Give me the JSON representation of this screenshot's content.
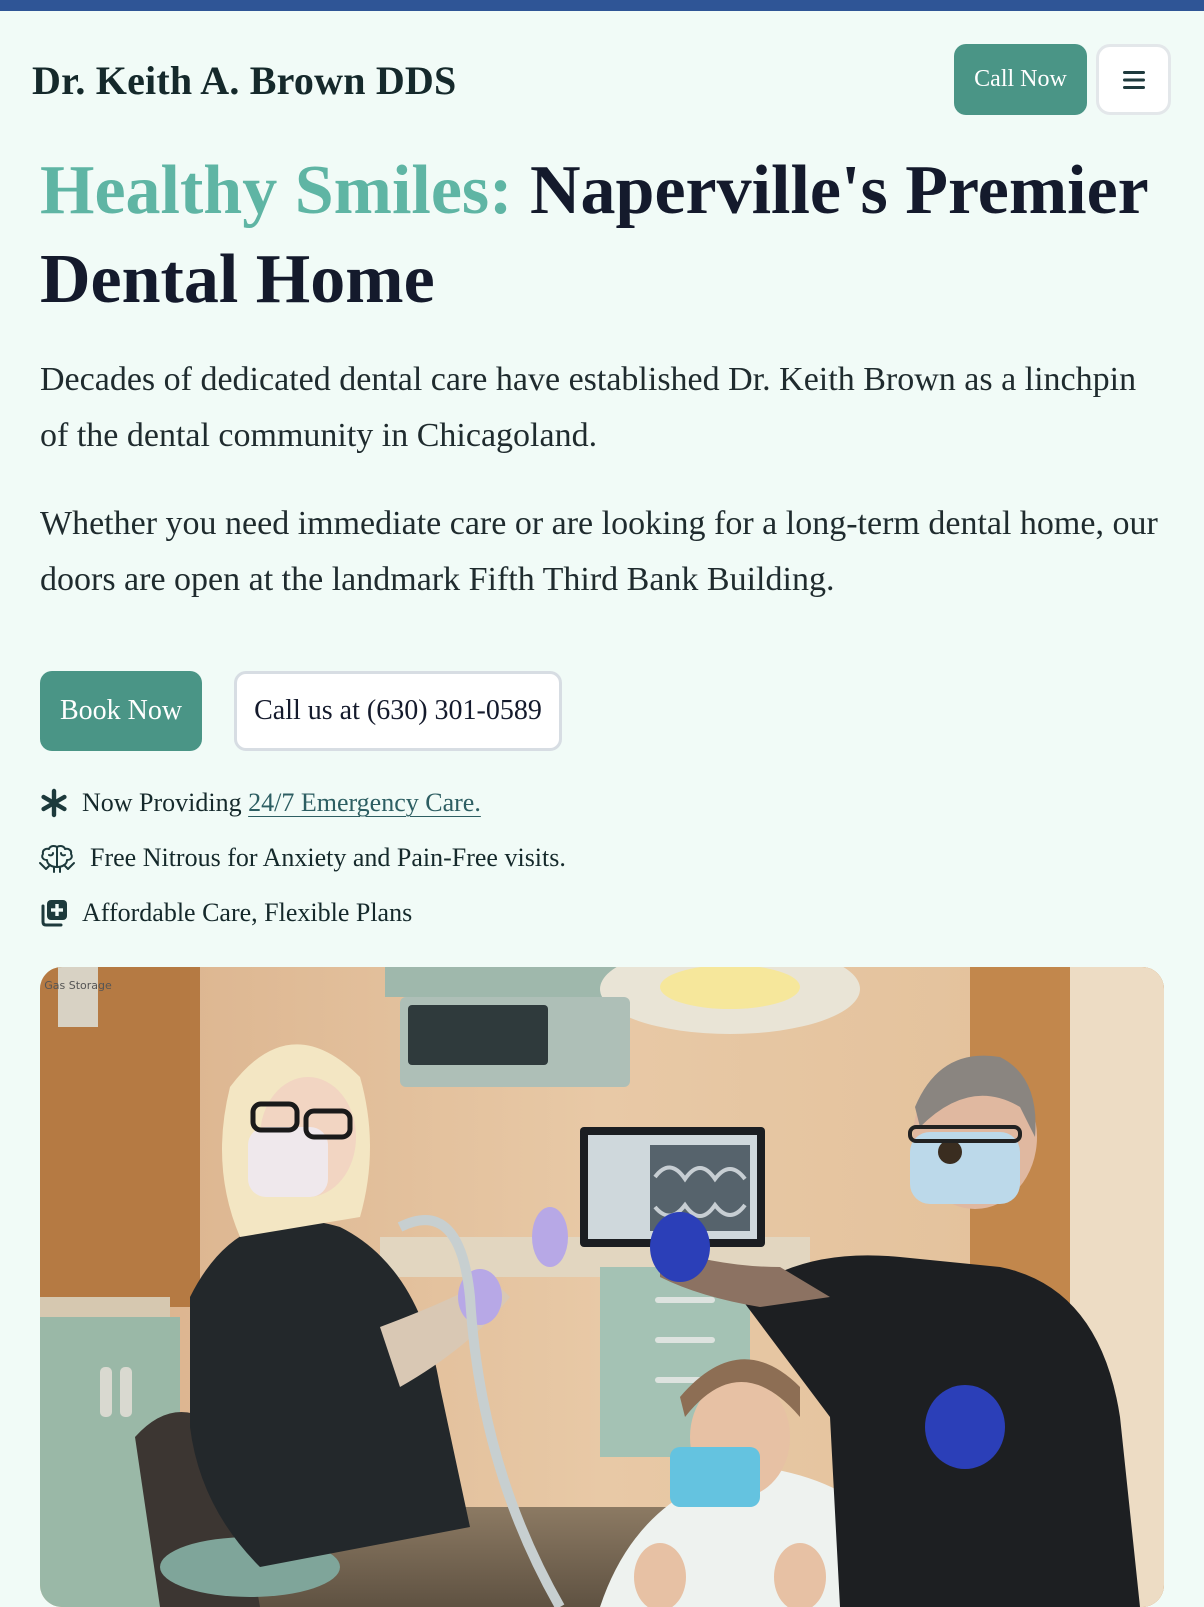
{
  "header": {
    "brand": "Dr. Keith A. Brown DDS",
    "call_now_label": "Call Now",
    "menu_icon": "hamburger-menu-icon"
  },
  "hero": {
    "title_accent": "Healthy Smiles:",
    "title_rest": " Naperville's Premier Dental Home",
    "paragraph1": "Decades of dedicated dental care have established Dr. Keith Brown as a linchpin of the dental community in Chicagoland.",
    "paragraph2": "Whether you need immediate care or are looking for a long-term dental home, our doors are open at the landmark Fifth Third Bank Building."
  },
  "actions": {
    "book_now": "Book Now",
    "call_us": "Call us at (630) 301-0589"
  },
  "features": [
    {
      "icon": "asterisk-icon",
      "prefix": "Now Providing ",
      "link": "24/7 Emergency Care."
    },
    {
      "icon": "brain-icon",
      "text": "Free Nitrous for Anxiety and Pain-Free visits."
    },
    {
      "icon": "medical-plus-icon",
      "text": "Affordable Care, Flexible Plans"
    }
  ],
  "colors": {
    "top_bar": "#2f5596",
    "page_bg": "#f1fbf7",
    "accent": "#5fb5a4",
    "button": "#4a9586",
    "heading": "#141a2c"
  },
  "photo": {
    "sign_text": "Gas Storage"
  }
}
